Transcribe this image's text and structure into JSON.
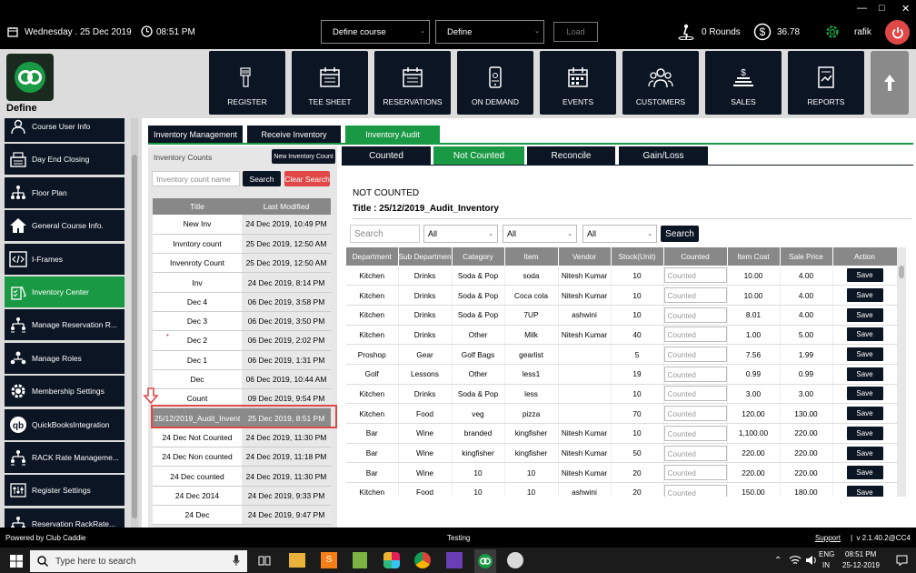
{
  "topbar": {
    "date": "Wednesday .  25 Dec 2019",
    "time": "08:51 PM",
    "course_select": "Define  course",
    "define_select": "Define",
    "load_label": "Load",
    "rounds": "0 Rounds",
    "balance": "36.78",
    "user": "rafik"
  },
  "logo": {
    "label": "Define"
  },
  "nav": [
    {
      "label": "REGISTER",
      "icon": "barcode-scanner-icon"
    },
    {
      "label": "TEE SHEET",
      "icon": "calendar-icon"
    },
    {
      "label": "RESERVATIONS",
      "icon": "calendar-icon"
    },
    {
      "label": "ON DEMAND",
      "icon": "mobile-icon"
    },
    {
      "label": "EVENTS",
      "icon": "events-icon"
    },
    {
      "label": "CUSTOMERS",
      "icon": "customers-icon"
    },
    {
      "label": "SALES",
      "icon": "sales-icon"
    },
    {
      "label": "REPORTS",
      "icon": "reports-icon"
    }
  ],
  "sidebar": {
    "items": [
      {
        "label": "Course User Info",
        "icon": "user-info-icon"
      },
      {
        "label": "Day End Closing",
        "icon": "register-icon"
      },
      {
        "label": "Floor Plan",
        "icon": "floor-plan-icon"
      },
      {
        "label": "General Course Info.",
        "icon": "home-icon"
      },
      {
        "label": "I-Frames",
        "icon": "code-icon"
      },
      {
        "label": "Inventory Center",
        "icon": "inventory-icon",
        "active": true
      },
      {
        "label": "Manage Reservation R...",
        "icon": "hierarchy-icon"
      },
      {
        "label": "Manage Roles",
        "icon": "roles-icon"
      },
      {
        "label": "Membership Settings",
        "icon": "gear-icon"
      },
      {
        "label": "QuickBooksIntegration",
        "icon": "quickbooks-icon"
      },
      {
        "label": "RACK Rate Manageme...",
        "icon": "hierarchy-icon"
      },
      {
        "label": "Register Settings",
        "icon": "settings-icon"
      },
      {
        "label": "Reservation RackRate...",
        "icon": "hierarchy-icon"
      }
    ]
  },
  "tabs": {
    "main": [
      "Inventory Management",
      "Receive Inventory",
      "Inventory Audit"
    ],
    "sub": [
      "Counted",
      "Not Counted",
      "Reconcile",
      "Gain/Loss"
    ]
  },
  "counts": {
    "header": "Inventory Counts",
    "new_button": "New Inventory Count",
    "search_placeholder": "Inventory count name",
    "search_button": "Search",
    "clear_button": "Clear Search",
    "columns": [
      "Title",
      "Last Modified"
    ],
    "rows": [
      {
        "title": "New Inv",
        "modified": "24 Dec 2019, 10:49 PM"
      },
      {
        "title": "Invntory count",
        "modified": "25 Dec 2019, 12:50 AM"
      },
      {
        "title": "Invenroty Count",
        "modified": "25 Dec 2019, 12:50 AM"
      },
      {
        "title": "Inv",
        "modified": "24 Dec 2019, 8:14 PM"
      },
      {
        "title": "Dec 4",
        "modified": "06 Dec 2019, 3:58 PM"
      },
      {
        "title": "Dec 3",
        "modified": "06 Dec 2019, 3:50 PM"
      },
      {
        "title": "Dec 2",
        "modified": "06 Dec 2019, 2:02 PM"
      },
      {
        "title": "Dec 1",
        "modified": "06 Dec 2019, 1:31 PM"
      },
      {
        "title": "Dec",
        "modified": "06 Dec 2019, 10:44 AM"
      },
      {
        "title": "Count",
        "modified": "09 Dec 2019, 9:54 PM"
      },
      {
        "title": "25/12/2019_Audit_Invent",
        "modified": "25 Dec 2019, 8:51 PM",
        "selected": true
      },
      {
        "title": "24 Dec Not Counted",
        "modified": "24 Dec 2019, 11:30 PM"
      },
      {
        "title": "24 Dec Non counted",
        "modified": "24 Dec 2019, 11:18 PM"
      },
      {
        "title": "24 Dec counted",
        "modified": "24 Dec 2019, 11:30 PM"
      },
      {
        "title": "24 Dec 2014",
        "modified": "24 Dec 2019, 9:33 PM"
      },
      {
        "title": "24 Dec",
        "modified": "24 Dec 2019, 9:47 PM"
      }
    ]
  },
  "audit": {
    "status": "NOT COUNTED",
    "title": "Title : 25/12/2019_Audit_Inventory",
    "search_placeholder": "Search",
    "filters": [
      "All",
      "All",
      "All"
    ],
    "search_button": "Search",
    "columns": [
      "Department",
      "Sub Department",
      "Category",
      "Item",
      "Vendor",
      "Stock(Unit)",
      "Counted",
      "Item Cost",
      "Sale Price",
      "Action"
    ],
    "counted_placeholder": "Counted",
    "save_label": "Save",
    "rows": [
      [
        "Kitchen",
        "Drinks",
        "Soda & Pop",
        "soda",
        "Nitesh Kumar",
        "10",
        "10.00",
        "4.00"
      ],
      [
        "Kitchen",
        "Drinks",
        "Soda & Pop",
        "Coca cola",
        "Nitesh Kumar",
        "10",
        "10.00",
        "4.00"
      ],
      [
        "Kitchen",
        "Drinks",
        "Soda & Pop",
        "7UP",
        "ashwini",
        "10",
        "8.01",
        "4.00"
      ],
      [
        "Kitchen",
        "Drinks",
        "Other",
        "Milk",
        "Nitesh Kumar",
        "40",
        "1.00",
        "5.00"
      ],
      [
        "Proshop",
        "Gear",
        "Golf Bags",
        "gearlist",
        "",
        "5",
        "7.56",
        "1.99"
      ],
      [
        "Golf",
        "Lessons",
        "Other",
        "less1",
        "",
        "19",
        "0.99",
        "0.99"
      ],
      [
        "Kitchen",
        "Drinks",
        "Soda & Pop",
        "less",
        "",
        "10",
        "3.00",
        "3.00"
      ],
      [
        "Kitchen",
        "Food",
        "veg",
        "pizza",
        "",
        "70",
        "120.00",
        "130.00"
      ],
      [
        "Bar",
        "Wine",
        "branded",
        "kingfisher",
        "Nitesh Kumar",
        "10",
        "1,100.00",
        "220.00"
      ],
      [
        "Bar",
        "Wine",
        "kingfisher",
        "kingfisher",
        "Nitesh Kumar",
        "50",
        "220.00",
        "220.00"
      ],
      [
        "Bar",
        "Wine",
        "10",
        "10",
        "Nitesh Kumar",
        "20",
        "220.00",
        "220.00"
      ],
      [
        "Kitchen",
        "Food",
        "10",
        "10",
        "ashwini",
        "20",
        "150.00",
        "180.00"
      ]
    ]
  },
  "statusbar": {
    "powered": "Powered by Club Caddie",
    "env": "Testing",
    "support": "Support",
    "version": "v 2.1.40.2@CC4"
  },
  "taskbar": {
    "search_placeholder": "Type here to search",
    "lang1": "ENG",
    "lang2": "IN",
    "time": "08:51 PM",
    "date": "25-12-2019"
  },
  "colors": {
    "navy": "#0b1523",
    "green": "#1a9944",
    "red_accent": "#e04848"
  }
}
